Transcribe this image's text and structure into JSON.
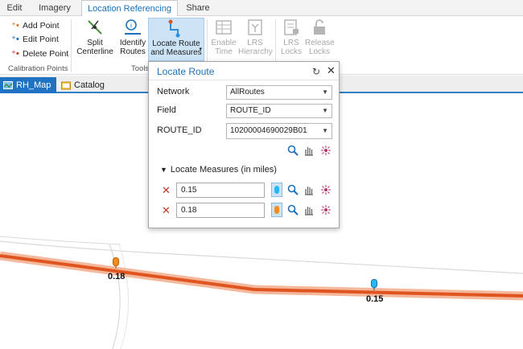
{
  "ribbon_tabs": [
    "Edit",
    "Imagery",
    "Location Referencing",
    "Share"
  ],
  "calibration": {
    "add_point": "Add Point",
    "edit_point": "Edit Point",
    "delete_point": "Delete Point",
    "group_label": "Calibration Points"
  },
  "tools": {
    "split_line1": "Split",
    "split_line2": "Centerline",
    "identify_line1": "Identify",
    "identify_line2": "Routes",
    "locate_line1": "Locate Route",
    "locate_line2": "and Measures",
    "group_label": "Tools"
  },
  "disabled_tools": {
    "enable_line1": "Enable",
    "enable_line2": "Time",
    "lrs_h_line1": "LRS",
    "lrs_h_line2": "Hierarchy",
    "lrs_locks_line1": "LRS",
    "lrs_locks_line2": "Locks",
    "release_line1": "Release",
    "release_line2": "Locks"
  },
  "views": {
    "map_tab": "RH_Map",
    "catalog_tab": "Catalog"
  },
  "pane": {
    "title": "Locate Route",
    "network_label": "Network",
    "network_value": "AllRoutes",
    "field_label": "Field",
    "field_value": "ROUTE_ID",
    "route_id_label": "ROUTE_ID",
    "route_id_value": "10200004690029B01",
    "measures_section": "Locate Measures (in miles)",
    "measures": [
      "0.15",
      "0.18"
    ]
  },
  "map_labels": {
    "label_a": "0.18",
    "label_b": "0.15"
  },
  "colors": {
    "accent": "#1e6fb8",
    "route_orange": "#e0551f",
    "pin_orange": "#f28c1c",
    "pin_blue": "#29b6f6",
    "delete_red": "#c0392b"
  }
}
